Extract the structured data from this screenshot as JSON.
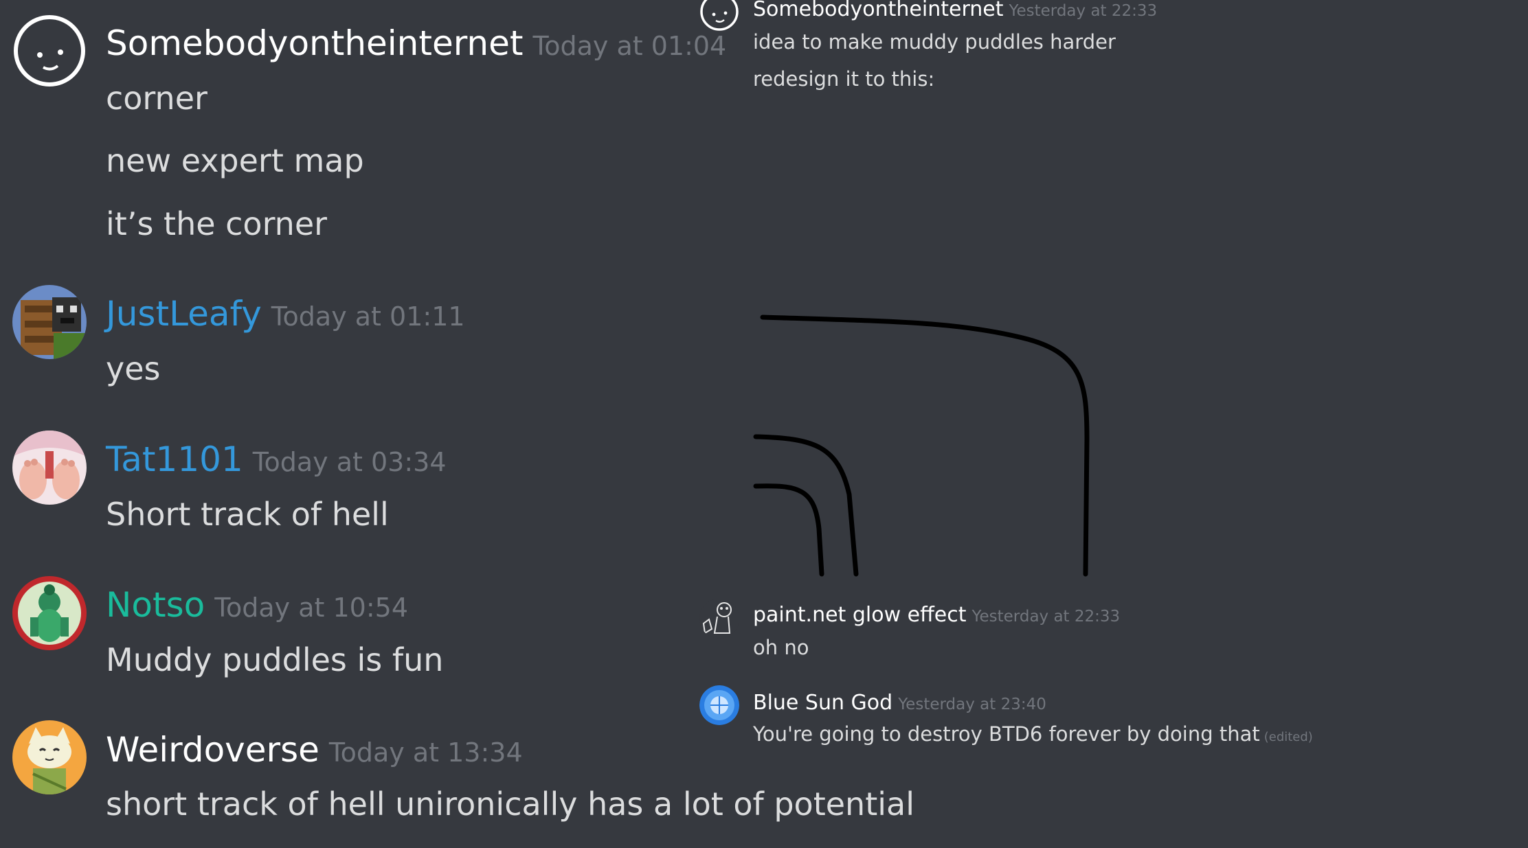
{
  "left_messages": [
    {
      "username": "Somebodyontheinternet",
      "username_color": "#ffffff",
      "timestamp": "Today at 01:04",
      "lines": [
        "corner",
        "new expert map",
        "it’s the corner"
      ]
    },
    {
      "username": "JustLeafy",
      "username_color": "#3498db",
      "timestamp": "Today at 01:11",
      "lines": [
        "yes"
      ]
    },
    {
      "username": "Tat1101",
      "username_color": "#3498db",
      "timestamp": "Today at 03:34",
      "lines": [
        "Short track of hell"
      ]
    },
    {
      "username": "Notso",
      "username_color": "#1abc9c",
      "timestamp": "Today at 10:54",
      "lines": [
        "Muddy puddles is fun"
      ]
    },
    {
      "username": "Weirdoverse",
      "username_color": "#ffffff",
      "timestamp": "Today at 13:34",
      "lines": [
        "short track of hell unironically has a lot of potential"
      ]
    }
  ],
  "right_messages": [
    {
      "username": "Somebodyontheinternet",
      "username_color": "#ffffff",
      "timestamp": "Yesterday at 22:33",
      "lines": [
        "idea to make muddy puddles harder",
        "redesign it to this:"
      ],
      "attachment": "drawn-track-image"
    },
    {
      "username": "paint.net glow effect",
      "username_color": "#ffffff",
      "timestamp": "Yesterday at 22:33",
      "lines": [
        "oh no"
      ]
    },
    {
      "username": "Blue Sun God",
      "username_color": "#ffffff",
      "timestamp": "Yesterday at 23:40",
      "lines": [
        "You're going to destroy BTD6 forever by doing that"
      ],
      "edited_label": "(edited)"
    }
  ],
  "icons": {
    "avatar_somebody": "smiley-face-avatar",
    "avatar_justleafy": "minecraft-block-avatar",
    "avatar_tat": "anime-character-avatar",
    "avatar_notso": "green-character-avatar",
    "avatar_weirdoverse": "cat-avatar",
    "avatar_paintnet": "sketch-character-avatar",
    "avatar_bluesun": "blue-globe-avatar"
  },
  "colors": {
    "background": "#36393f",
    "message_text": "#dcddde",
    "timestamp": "#72767d"
  }
}
